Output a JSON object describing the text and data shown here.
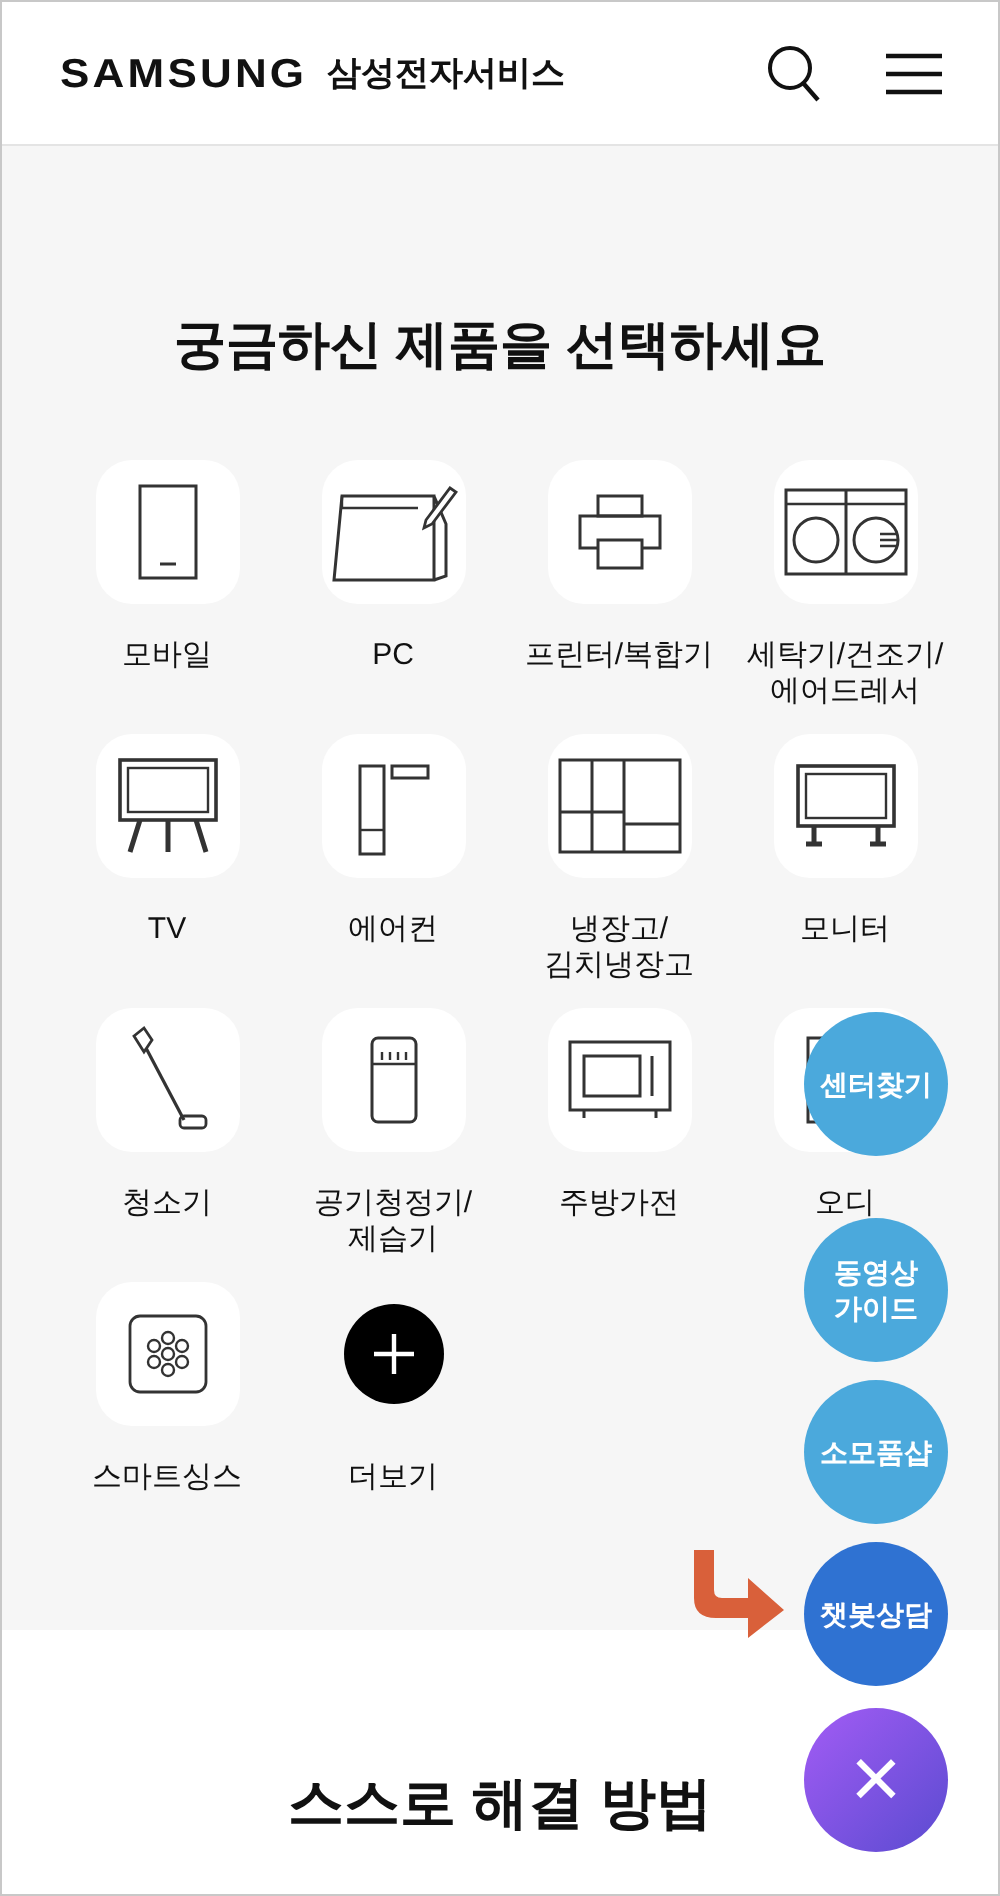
{
  "header": {
    "logo": "SAMSUNG",
    "service_name": "삼성전자서비스"
  },
  "products": {
    "title": "궁금하신 제품을 선택하세요",
    "items": [
      {
        "label": "모바일",
        "kind": "category"
      },
      {
        "label": "PC",
        "kind": "category"
      },
      {
        "label": "프린터/복합기",
        "kind": "category"
      },
      {
        "label": "세탁기/건조기/\n에어드레서",
        "kind": "category"
      },
      {
        "label": "TV",
        "kind": "category"
      },
      {
        "label": "에어컨",
        "kind": "category"
      },
      {
        "label": "냉장고/\n김치냉장고",
        "kind": "category"
      },
      {
        "label": "모니터",
        "kind": "category"
      },
      {
        "label": "청소기",
        "kind": "category"
      },
      {
        "label": "공기청정기/\n제습기",
        "kind": "category"
      },
      {
        "label": "주방가전",
        "kind": "category"
      },
      {
        "label": "오디",
        "kind": "category"
      },
      {
        "label": "스마트싱스",
        "kind": "category"
      },
      {
        "label": "더보기",
        "kind": "more"
      }
    ]
  },
  "self_help": {
    "title": "스스로 해결 방법"
  },
  "floating_menu": [
    {
      "label": "센터찾기",
      "kind": "link"
    },
    {
      "label": "동영상\n가이드",
      "kind": "link"
    },
    {
      "label": "소모품샵",
      "kind": "link"
    },
    {
      "label": "챗봇상담",
      "kind": "chatbot"
    },
    {
      "label": "×",
      "kind": "close"
    }
  ]
}
